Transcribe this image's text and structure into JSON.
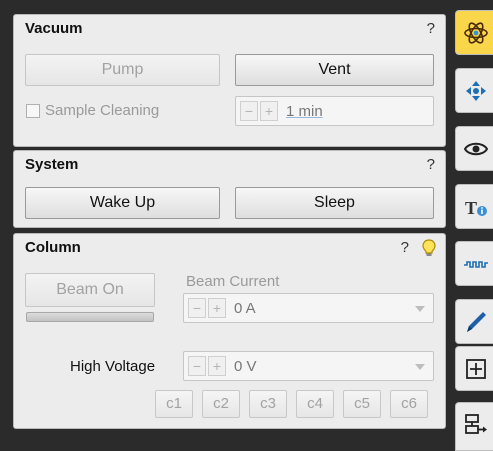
{
  "vacuum": {
    "title": "Vacuum",
    "help": "?",
    "pump_label": "Pump",
    "vent_label": "Vent",
    "sample_cleaning_label": "Sample Cleaning",
    "cleaning_time": "1 min"
  },
  "system": {
    "title": "System",
    "help": "?",
    "wake_up_label": "Wake Up",
    "sleep_label": "Sleep"
  },
  "column": {
    "title": "Column",
    "help": "?",
    "beam_on_label": "Beam On",
    "beam_current_label": "Beam Current",
    "beam_current_value": "0 A",
    "high_voltage_label": "High Voltage",
    "high_voltage_value": "0 V",
    "presets": [
      "c1",
      "c2",
      "c3",
      "c4",
      "c5",
      "c6"
    ]
  },
  "spinner": {
    "minus": "−",
    "plus": "+"
  },
  "toolbar": {
    "active_color": "#fad64b",
    "items": [
      "atom-icon",
      "move-arrows-icon",
      "eye-icon",
      "text-info-icon",
      "waveform-icon",
      "pen-icon",
      "crosshair-box-icon",
      "flow-export-icon"
    ]
  }
}
